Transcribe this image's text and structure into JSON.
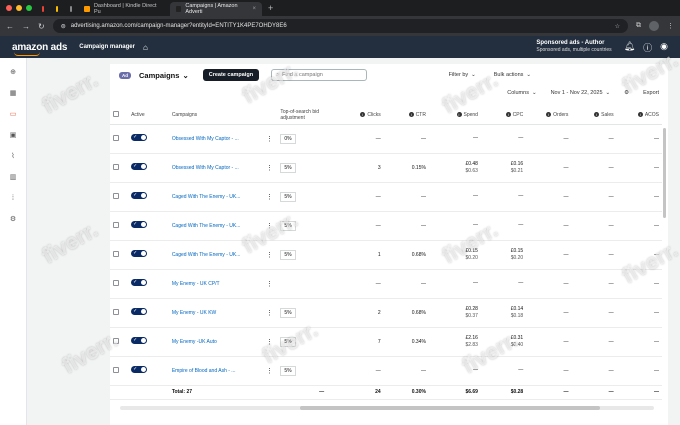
{
  "browser": {
    "tabs": [
      {
        "label": "Dashboard | Kindle Direct Pu"
      },
      {
        "label": "Campaigns | Amazon Adverti"
      }
    ],
    "url": "advertising.amazon.com/campaign-manager?entityId=ENTITY1K4PE7OHDY8E6"
  },
  "topnav": {
    "logo": "amazon ads",
    "section": "Campaign manager",
    "account_name": "Sponsored ads - Author",
    "account_sub": "Sponsored ads, multiple countries"
  },
  "header": {
    "badge": "Ad",
    "title": "Campaigns",
    "create_label": "Create campaign",
    "search_placeholder": "Find a campaign",
    "filter_label": "Filter by",
    "bulk_label": "Bulk actions",
    "columns_label": "Columns",
    "date_range": "Nov 1 - Nov 22, 2025",
    "export_label": "Export"
  },
  "table": {
    "columns": {
      "active": "Active",
      "campaigns": "Campaigns",
      "bid": "Top-of-search bid adjustment",
      "clicks": "Clicks",
      "ctr": "CTR",
      "spend": "Spend",
      "cpc": "CPC",
      "orders": "Orders",
      "sales": "Sales",
      "acos": "ACOS"
    },
    "rows": [
      {
        "name": "Obsessed With My Captor - ...",
        "bid": "0%",
        "clicks": "—",
        "ctr": "—",
        "spend": "—",
        "spend2": "",
        "cpc": "—",
        "cpc2": "",
        "orders": "—",
        "sales": "—",
        "acos": "—"
      },
      {
        "name": "Obsessed With My Captor - ...",
        "bid": "5%",
        "clicks": "3",
        "ctr": "0.15%",
        "spend": "£0.48",
        "spend2": "$0.63",
        "cpc": "£0.16",
        "cpc2": "$0.21",
        "orders": "—",
        "sales": "—",
        "acos": "—"
      },
      {
        "name": "Caged With The Enemy - UK...",
        "bid": "5%",
        "clicks": "—",
        "ctr": "—",
        "spend": "—",
        "spend2": "",
        "cpc": "—",
        "cpc2": "",
        "orders": "—",
        "sales": "—",
        "acos": "—"
      },
      {
        "name": "Caged With The Enemy - UK...",
        "bid": "5%",
        "clicks": "—",
        "ctr": "—",
        "spend": "—",
        "spend2": "",
        "cpc": "—",
        "cpc2": "",
        "orders": "—",
        "sales": "—",
        "acos": "—"
      },
      {
        "name": "Caged With The Enemy - UK...",
        "bid": "5%",
        "clicks": "1",
        "ctr": "0.68%",
        "spend": "£0.15",
        "spend2": "$0.20",
        "cpc": "£0.15",
        "cpc2": "$0.20",
        "orders": "—",
        "sales": "—",
        "acos": "—"
      },
      {
        "name": "My Enemy - UK CP/T",
        "bid": "",
        "clicks": "—",
        "ctr": "—",
        "spend": "—",
        "spend2": "",
        "cpc": "—",
        "cpc2": "",
        "orders": "—",
        "sales": "—",
        "acos": "—"
      },
      {
        "name": "My Enemy - UK KW",
        "bid": "5%",
        "clicks": "2",
        "ctr": "0.68%",
        "spend": "£0.28",
        "spend2": "$0.37",
        "cpc": "£0.14",
        "cpc2": "$0.18",
        "orders": "—",
        "sales": "—",
        "acos": "—"
      },
      {
        "name": "My Enemy -UK Auto",
        "bid": "5%",
        "clicks": "7",
        "ctr": "0.34%",
        "spend": "£2.16",
        "spend2": "$2.83",
        "cpc": "£0.31",
        "cpc2": "$0.40",
        "orders": "—",
        "sales": "—",
        "acos": "—"
      },
      {
        "name": "Empire of Blood and Ash - ...",
        "bid": "5%",
        "clicks": "—",
        "ctr": "—",
        "spend": "—",
        "spend2": "",
        "cpc": "—",
        "cpc2": "",
        "orders": "—",
        "sales": "—",
        "acos": "—"
      }
    ],
    "total": {
      "label": "Total: 27",
      "bid": "—",
      "clicks": "24",
      "ctr": "0.30%",
      "spend": "$6.69",
      "cpc": "$0.28",
      "orders": "—",
      "sales": "—",
      "acos": "—"
    }
  },
  "watermark": "fiverr."
}
